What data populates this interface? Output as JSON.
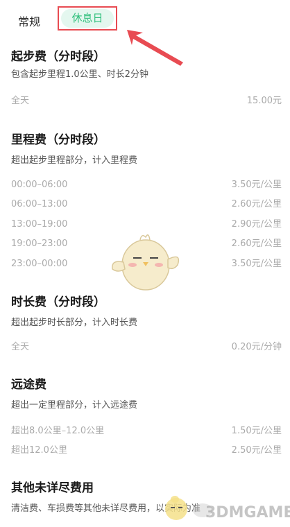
{
  "tabs": {
    "regular": "常规",
    "holiday": "休息日"
  },
  "sections": {
    "start": {
      "title": "起步费（分时段）",
      "desc": "包含起步里程1.0公里、时长2分钟",
      "rows": [
        {
          "label": "全天",
          "value": "15.00元"
        }
      ]
    },
    "mileage": {
      "title": "里程费（分时段）",
      "desc": "超出起步里程部分，计入里程费",
      "rows": [
        {
          "label": "00:00–06:00",
          "value": "3.50元/公里"
        },
        {
          "label": "06:00–13:00",
          "value": "2.60元/公里"
        },
        {
          "label": "13:00–19:00",
          "value": "2.90元/公里"
        },
        {
          "label": "19:00–23:00",
          "value": "2.60元/公里"
        },
        {
          "label": "23:00–00:00",
          "value": "3.50元/公里"
        }
      ]
    },
    "duration": {
      "title": "时长费（分时段）",
      "desc": "超出起步时长部分，计入时长费",
      "rows": [
        {
          "label": "全天",
          "value": "0.20元/分钟"
        }
      ]
    },
    "longdistance": {
      "title": "远途费",
      "desc": "超出一定里程部分，计入远途费",
      "rows": [
        {
          "label": "超出8.0公里–12.0公里",
          "value": "1.50元/公里"
        },
        {
          "label": "超出12.0公里",
          "value": "2.50元/公里"
        }
      ]
    },
    "other": {
      "title": "其他未详尽费用",
      "desc": "清洁费、车损费等其他未详尽费用，以实际为准"
    }
  },
  "watermark": {
    "text": "3DMGAME"
  },
  "colors": {
    "accent": "#2fbf7b",
    "highlight": "#e84b52"
  }
}
